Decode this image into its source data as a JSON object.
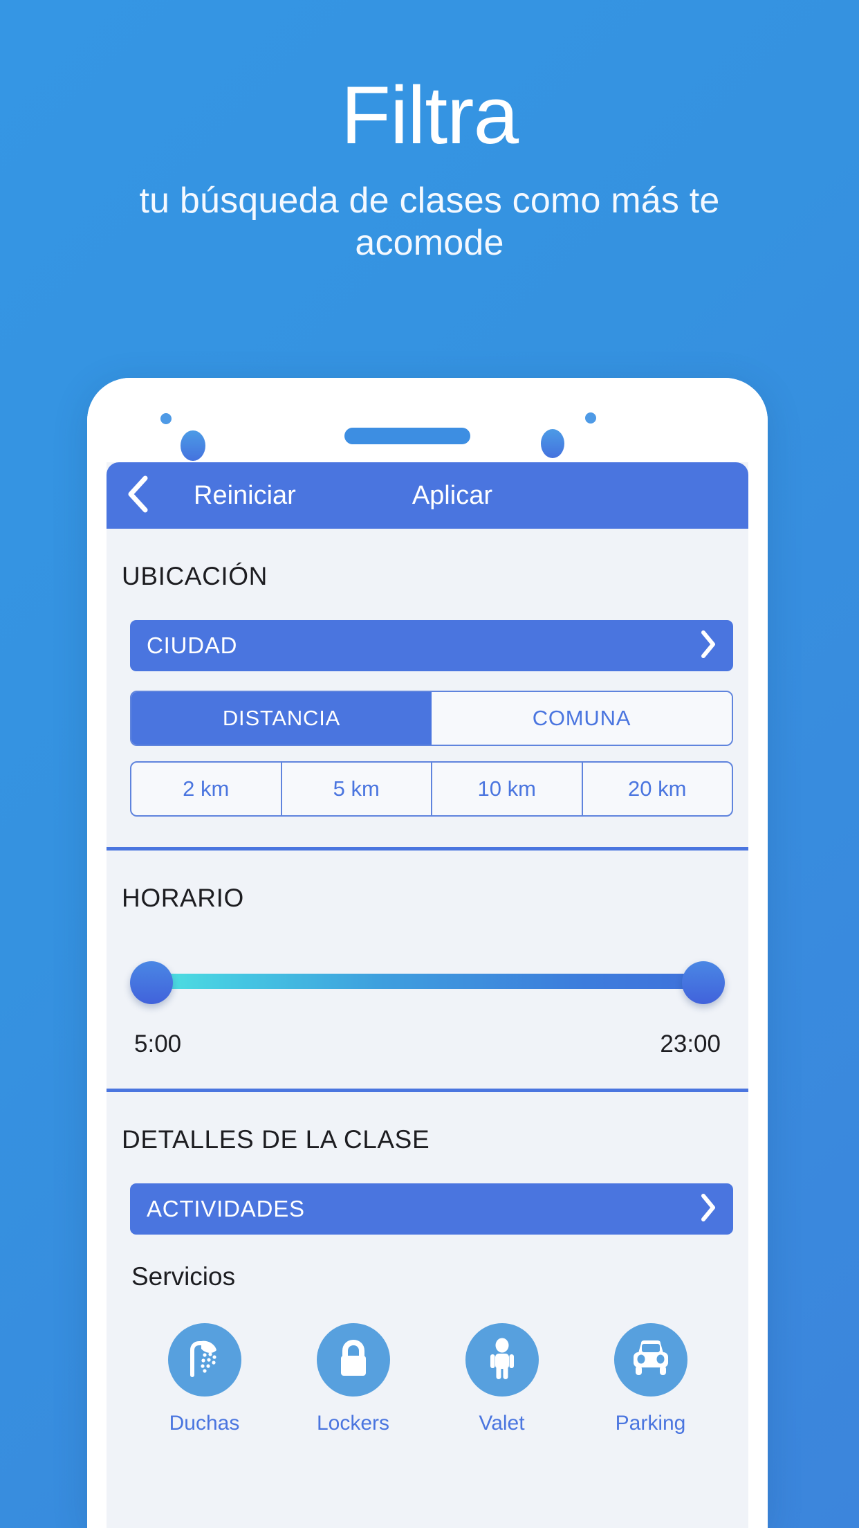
{
  "promo": {
    "title": "Filtra",
    "subtitle": "tu búsqueda de clases como más te acomode"
  },
  "colors": {
    "background": "#3392E0",
    "primary": "#4A75DF",
    "screen_bg": "#f0f3f8",
    "icon_circle": "#57A0DE",
    "slider_start": "#4ee0e0",
    "slider_end": "#3f72db"
  },
  "appbar": {
    "back_icon": "chevron-left-icon",
    "reset_label": "Reiniciar",
    "apply_label": "Aplicar"
  },
  "sections": {
    "location": {
      "title": "UBICACIÓN",
      "city_button": {
        "label": "CIUDAD",
        "chevron": "chevron-right-icon"
      },
      "mode_tabs": [
        {
          "label": "DISTANCIA",
          "selected": true
        },
        {
          "label": "COMUNA",
          "selected": false
        }
      ],
      "distances": [
        {
          "label": "2 km",
          "selected": false
        },
        {
          "label": "5 km",
          "selected": false
        },
        {
          "label": "10 km",
          "selected": false
        },
        {
          "label": "20 km",
          "selected": false
        }
      ]
    },
    "schedule": {
      "title": "HORARIO",
      "start_time": "5:00",
      "end_time": "23:00"
    },
    "class_details": {
      "title": "DETALLES DE LA CLASE",
      "activities_button": {
        "label": "ACTIVIDADES",
        "chevron": "chevron-right-icon"
      },
      "services_label": "Servicios",
      "services": [
        {
          "label": "Duchas",
          "icon": "shower-icon"
        },
        {
          "label": "Lockers",
          "icon": "lock-icon"
        },
        {
          "label": "Valet",
          "icon": "person-icon"
        },
        {
          "label": "Parking",
          "icon": "car-icon"
        }
      ]
    }
  }
}
